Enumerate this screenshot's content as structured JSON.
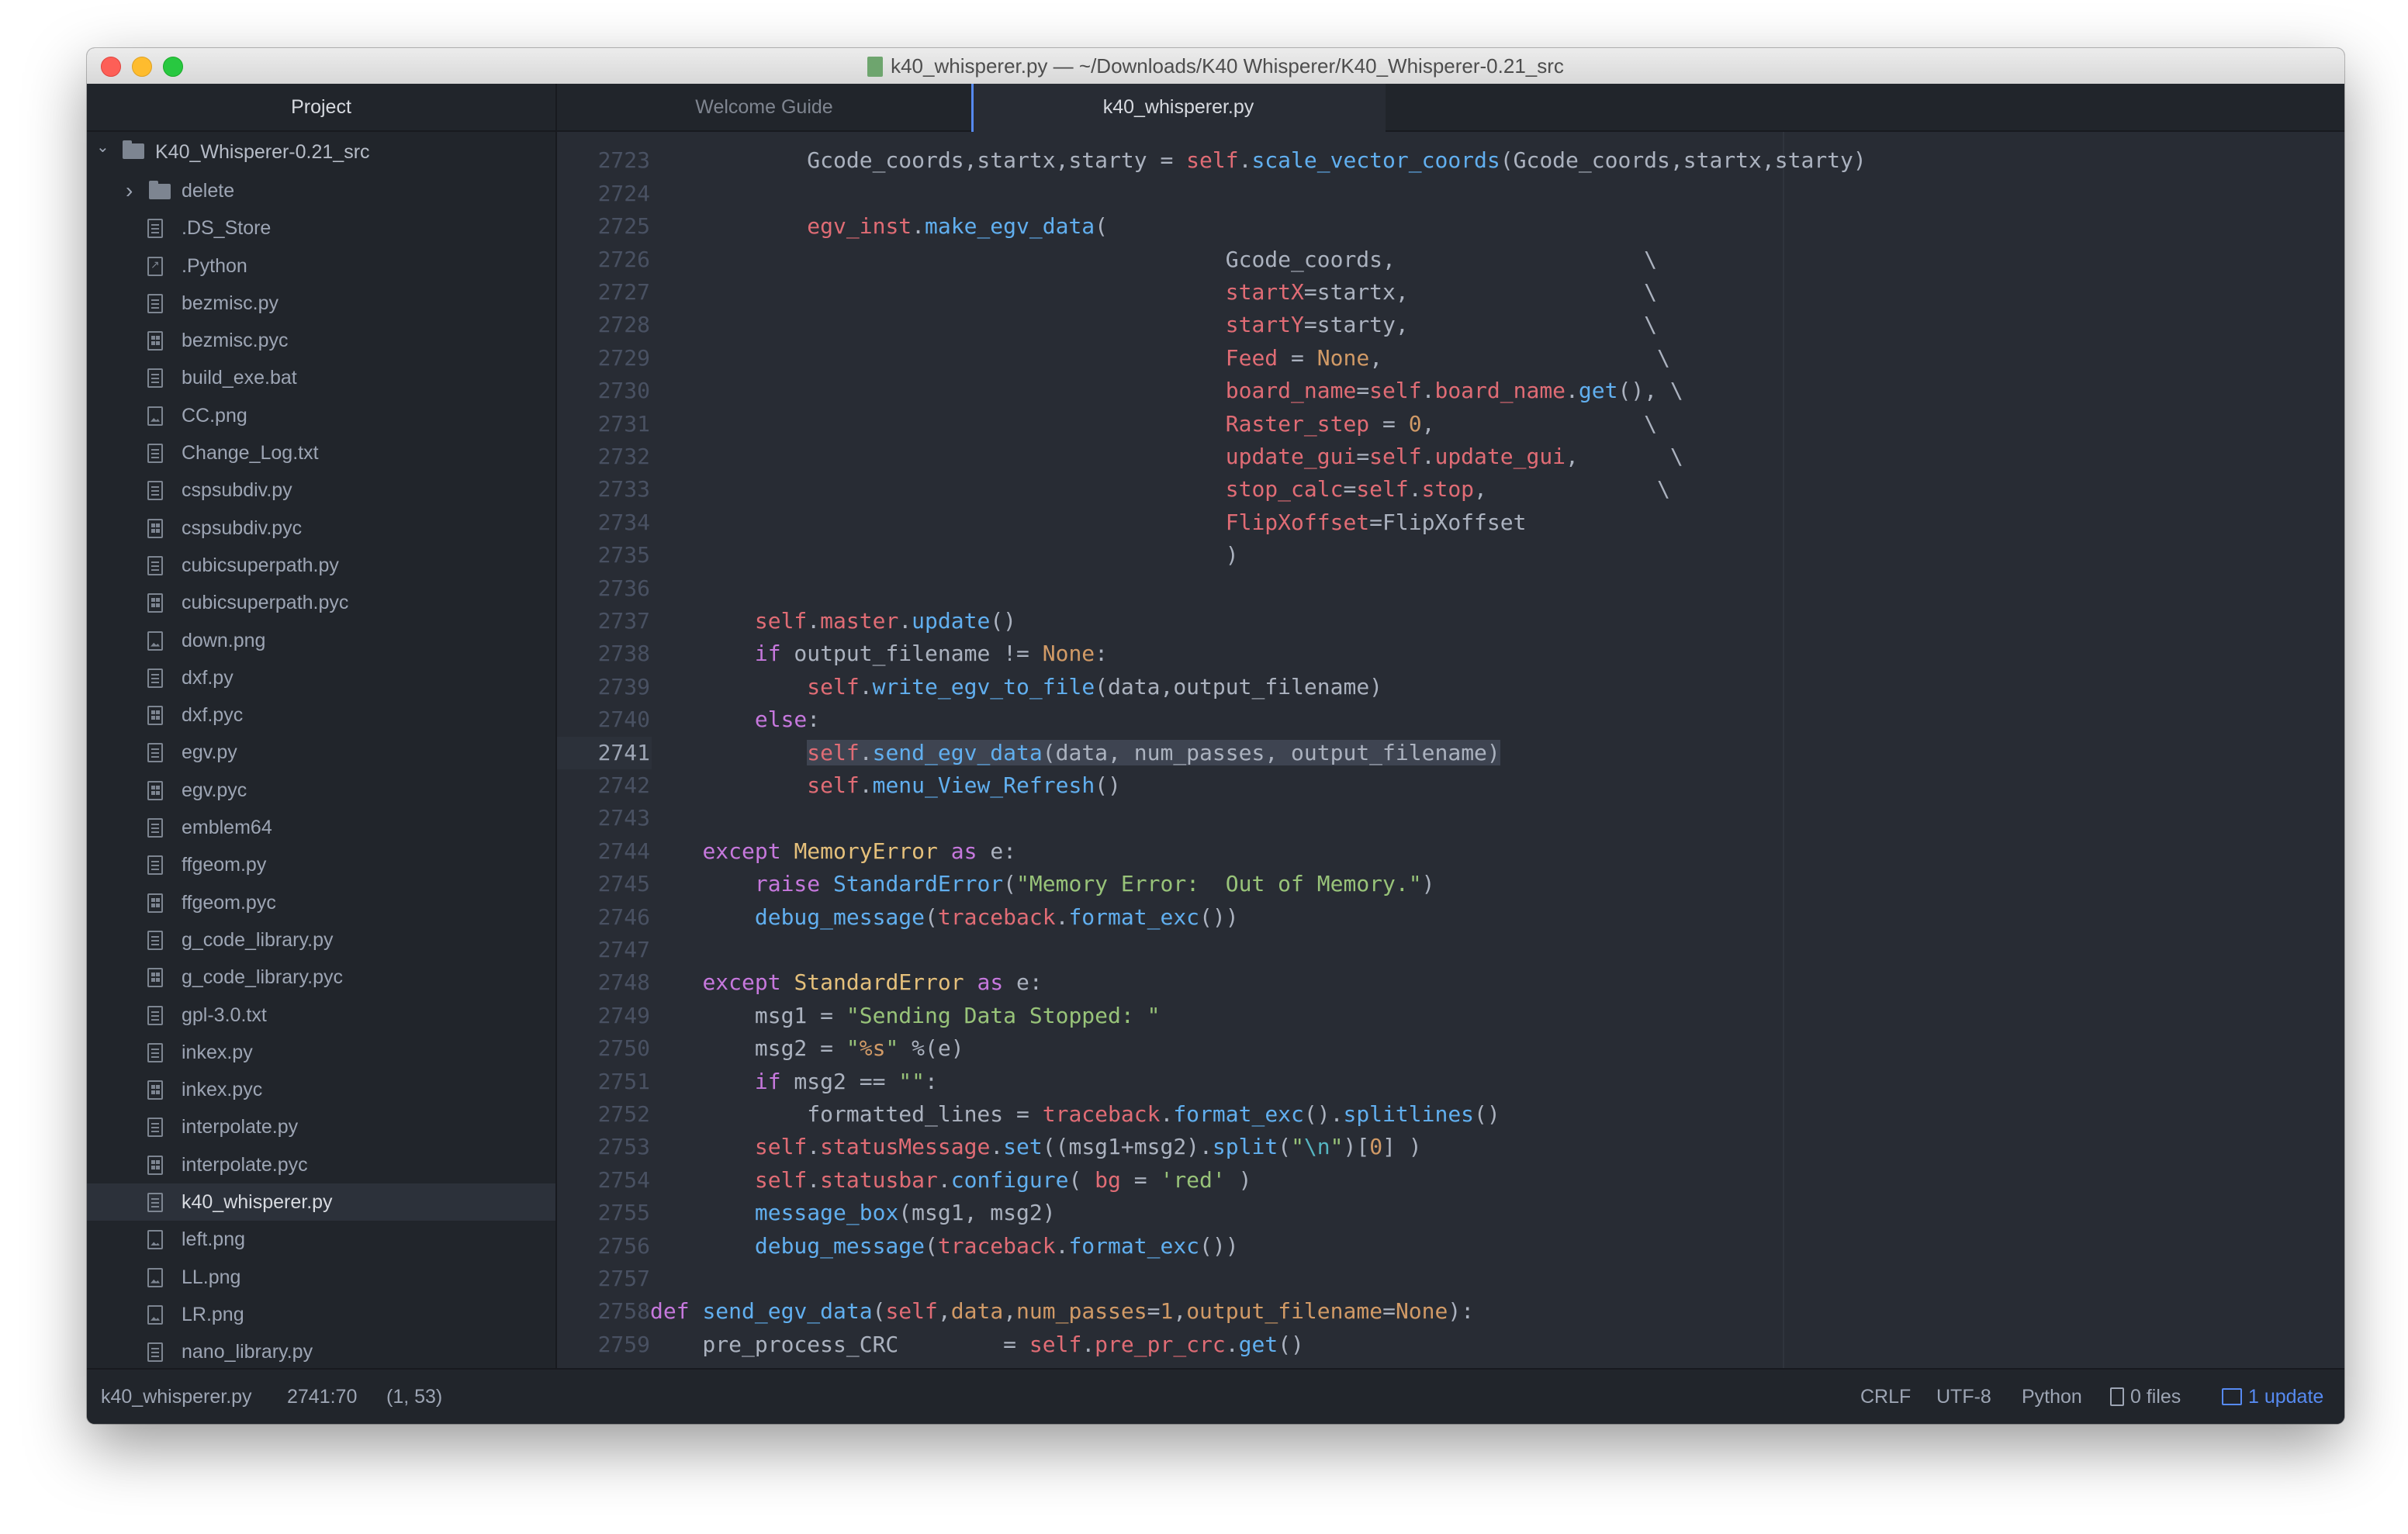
{
  "window": {
    "title": "k40_whisperer.py — ~/Downloads/K40 Whisperer/K40_Whisperer-0.21_src"
  },
  "tree": {
    "header": "Project",
    "root": "K40_Whisperer-0.21_src",
    "folder": "delete",
    "files": [
      {
        "name": ".DS_Store",
        "icon": "file-text-icon"
      },
      {
        "name": ".Python",
        "icon": "file-symlink-icon"
      },
      {
        "name": "bezmisc.py",
        "icon": "file-text-icon"
      },
      {
        "name": "bezmisc.pyc",
        "icon": "file-binary-icon"
      },
      {
        "name": "build_exe.bat",
        "icon": "file-text-icon"
      },
      {
        "name": "CC.png",
        "icon": "file-media-icon"
      },
      {
        "name": "Change_Log.txt",
        "icon": "file-text-icon"
      },
      {
        "name": "cspsubdiv.py",
        "icon": "file-text-icon"
      },
      {
        "name": "cspsubdiv.pyc",
        "icon": "file-binary-icon"
      },
      {
        "name": "cubicsuperpath.py",
        "icon": "file-text-icon"
      },
      {
        "name": "cubicsuperpath.pyc",
        "icon": "file-binary-icon"
      },
      {
        "name": "down.png",
        "icon": "file-media-icon"
      },
      {
        "name": "dxf.py",
        "icon": "file-text-icon"
      },
      {
        "name": "dxf.pyc",
        "icon": "file-binary-icon"
      },
      {
        "name": "egv.py",
        "icon": "file-text-icon"
      },
      {
        "name": "egv.pyc",
        "icon": "file-binary-icon"
      },
      {
        "name": "emblem64",
        "icon": "file-text-icon"
      },
      {
        "name": "ffgeom.py",
        "icon": "file-text-icon"
      },
      {
        "name": "ffgeom.pyc",
        "icon": "file-binary-icon"
      },
      {
        "name": "g_code_library.py",
        "icon": "file-text-icon"
      },
      {
        "name": "g_code_library.pyc",
        "icon": "file-binary-icon"
      },
      {
        "name": "gpl-3.0.txt",
        "icon": "file-text-icon"
      },
      {
        "name": "inkex.py",
        "icon": "file-text-icon"
      },
      {
        "name": "inkex.pyc",
        "icon": "file-binary-icon"
      },
      {
        "name": "interpolate.py",
        "icon": "file-text-icon"
      },
      {
        "name": "interpolate.pyc",
        "icon": "file-binary-icon"
      },
      {
        "name": "k40_whisperer.py",
        "icon": "file-text-icon",
        "selected": true
      },
      {
        "name": "left.png",
        "icon": "file-media-icon"
      },
      {
        "name": "LL.png",
        "icon": "file-media-icon"
      },
      {
        "name": "LR.png",
        "icon": "file-media-icon"
      },
      {
        "name": "nano_library.py",
        "icon": "file-text-icon"
      }
    ]
  },
  "tabs": [
    {
      "label": "Welcome Guide",
      "active": false
    },
    {
      "label": "k40_whisperer.py",
      "active": true
    }
  ],
  "editor": {
    "current_line": "2741",
    "lines": [
      {
        "n": "2723",
        "html": "            Gcode_coords,startx,starty = <span class=\"s\">self</span>.<span class=\"f\">scale_vector_coords</span>(Gcode_coords,startx,starty)"
      },
      {
        "n": "2724",
        "html": ""
      },
      {
        "n": "2725",
        "html": "            <span class=\"s\">egv_inst</span>.<span class=\"f\">make_egv_data</span>("
      },
      {
        "n": "2726",
        "html": "                                            Gcode_coords,                   \\"
      },
      {
        "n": "2727",
        "html": "                                            <span class=\"s\">startX</span>=startx,                  \\"
      },
      {
        "n": "2728",
        "html": "                                            <span class=\"s\">startY</span>=starty,                  \\"
      },
      {
        "n": "2729",
        "html": "                                            <span class=\"s\">Feed</span> = <span class=\"n\">None</span>,                     \\"
      },
      {
        "n": "2730",
        "html": "                                            <span class=\"s\">board_name</span>=<span class=\"s\">self</span>.<span class=\"s\">board_name</span>.<span class=\"f\">get</span>(), \\"
      },
      {
        "n": "2731",
        "html": "                                            <span class=\"s\">Raster_step</span> = <span class=\"n\">0</span>,                \\"
      },
      {
        "n": "2732",
        "html": "                                            <span class=\"s\">update_gui</span>=<span class=\"s\">self</span>.<span class=\"s\">update_gui</span>,       \\"
      },
      {
        "n": "2733",
        "html": "                                            <span class=\"s\">stop_calc</span>=<span class=\"s\">self</span>.<span class=\"s\">stop</span>,             \\"
      },
      {
        "n": "2734",
        "html": "                                            <span class=\"s\">FlipXoffset</span>=FlipXoffset"
      },
      {
        "n": "2735",
        "html": "                                            )"
      },
      {
        "n": "2736",
        "html": ""
      },
      {
        "n": "2737",
        "html": "        <span class=\"s\">self</span>.<span class=\"s\">master</span>.<span class=\"f\">update</span>()"
      },
      {
        "n": "2738",
        "html": "        <span class=\"k\">if</span> output_filename != <span class=\"n\">None</span>:"
      },
      {
        "n": "2739",
        "html": "            <span class=\"s\">self</span>.<span class=\"f\">write_egv_to_file</span>(data,output_filename)"
      },
      {
        "n": "2740",
        "html": "        <span class=\"k\">else</span>:"
      },
      {
        "n": "2741",
        "html": "            <span class=\"sel\"><span class=\"s\">self</span>.<span class=\"f\">send_egv_data</span>(data, num_passes, output_filename)</span>"
      },
      {
        "n": "2742",
        "html": "            <span class=\"s\">self</span>.<span class=\"f\">menu_View_Refresh</span>()"
      },
      {
        "n": "2743",
        "html": ""
      },
      {
        "n": "2744",
        "html": "    <span class=\"k\">except</span> <span class=\"c\">MemoryError</span> <span class=\"k\">as</span> e:"
      },
      {
        "n": "2745",
        "html": "        <span class=\"k\">raise</span> <span class=\"f\">StandardError</span>(<span class=\"str\">\"Memory Error:  Out of Memory.\"</span>)"
      },
      {
        "n": "2746",
        "html": "        <span class=\"f\">debug_message</span>(<span class=\"s\">traceback</span>.<span class=\"f\">format_exc</span>())"
      },
      {
        "n": "2747",
        "html": ""
      },
      {
        "n": "2748",
        "html": "    <span class=\"k\">except</span> <span class=\"c\">StandardError</span> <span class=\"k\">as</span> e:"
      },
      {
        "n": "2749",
        "html": "        msg1 = <span class=\"str\">\"Sending Data Stopped: \"</span>"
      },
      {
        "n": "2750",
        "html": "        msg2 = <span class=\"str\">\"<span class=\"n\">%s</span>\"</span> %(e)"
      },
      {
        "n": "2751",
        "html": "        <span class=\"k\">if</span> msg2 == <span class=\"str\">\"\"</span>:"
      },
      {
        "n": "2752",
        "html": "            formatted_lines = <span class=\"s\">traceback</span>.<span class=\"f\">format_exc</span>().<span class=\"f\">splitlines</span>()"
      },
      {
        "n": "2753",
        "html": "        <span class=\"s\">self</span>.<span class=\"s\">statusMessage</span>.<span class=\"f\">set</span>((msg1+msg2).<span class=\"f\">split</span>(<span class=\"str\">\"<span class=\"o\">\\n</span>\"</span>)[<span class=\"n\">0</span>] )"
      },
      {
        "n": "2754",
        "html": "        <span class=\"s\">self</span>.<span class=\"s\">statusbar</span>.<span class=\"f\">configure</span>( <span class=\"s\">bg</span> = <span class=\"str\">'red'</span> )"
      },
      {
        "n": "2755",
        "html": "        <span class=\"f\">message_box</span>(msg1, msg2)"
      },
      {
        "n": "2756",
        "html": "        <span class=\"f\">debug_message</span>(<span class=\"s\">traceback</span>.<span class=\"f\">format_exc</span>())"
      },
      {
        "n": "2757",
        "html": ""
      },
      {
        "n": "2758",
        "html": "<span class=\"k\">def</span> <span class=\"f\">send_egv_data</span>(<span class=\"s\">self</span>,<span class=\"n\">data</span>,<span class=\"n\">num_passes</span>=<span class=\"n\">1</span>,<span class=\"n\">output_filename</span>=<span class=\"n\">None</span>):"
      },
      {
        "n": "2759",
        "html": "    pre_process_CRC        = <span class=\"s\">self</span>.<span class=\"s\">pre_pr_crc</span>.<span class=\"f\">get</span>()"
      }
    ]
  },
  "status": {
    "file": "k40_whisperer.py",
    "cursor": "2741:70",
    "selection": "(1, 53)",
    "line_ending": "CRLF",
    "encoding": "UTF-8",
    "grammar": "Python",
    "git_files": "0 files",
    "updates": "1 update"
  }
}
